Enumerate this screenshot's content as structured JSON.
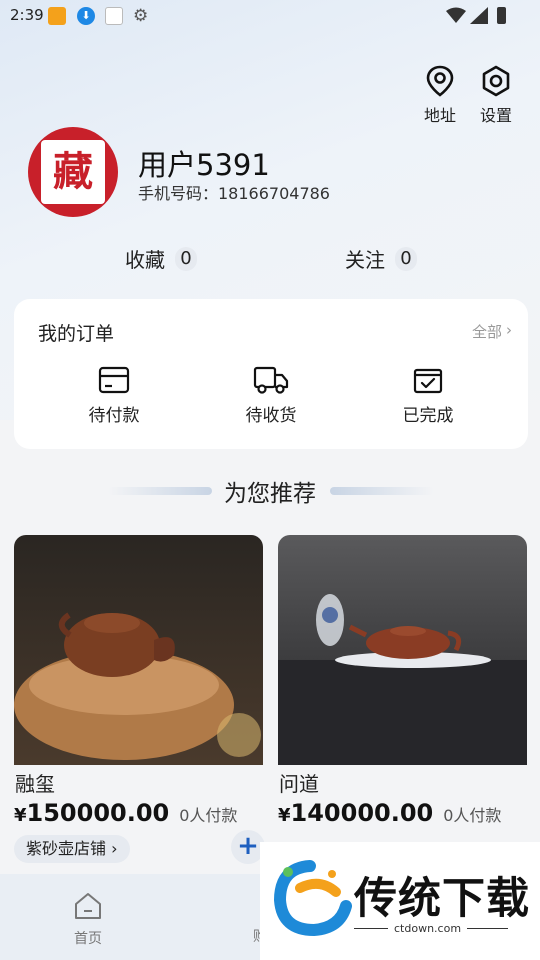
{
  "status_bar": {
    "time": "2:39"
  },
  "top_actions": {
    "address": "地址",
    "settings": "设置"
  },
  "profile": {
    "avatar_char": "藏",
    "name": "用户5391",
    "phone": "手机号码：18166704786"
  },
  "stats": {
    "favorites_label": "收藏",
    "favorites_count": "0",
    "follow_label": "关注",
    "follow_count": "0"
  },
  "orders": {
    "title": "我的订单",
    "all_label": "全部",
    "items": [
      {
        "label": "待付款",
        "icon": "card-icon"
      },
      {
        "label": "待收货",
        "icon": "truck-icon"
      },
      {
        "label": "已完成",
        "icon": "check-box-icon"
      }
    ]
  },
  "recommend": {
    "title": "为您推荐"
  },
  "products": [
    {
      "name": "融玺",
      "currency": "¥",
      "price": "150000.00",
      "paid": "0人付款",
      "shop": "紫砂壶店铺"
    },
    {
      "name": "问道",
      "currency": "¥",
      "price": "140000.00",
      "paid": "0人付款"
    }
  ],
  "bottom_nav": {
    "home": "首页",
    "cart_partial": "购"
  },
  "watermark": {
    "title": "传统下载",
    "url": "ctdown.com"
  },
  "colors": {
    "accent": "#1e5fbf",
    "avatar_red": "#c8202a",
    "background": "#f3f4f6"
  }
}
